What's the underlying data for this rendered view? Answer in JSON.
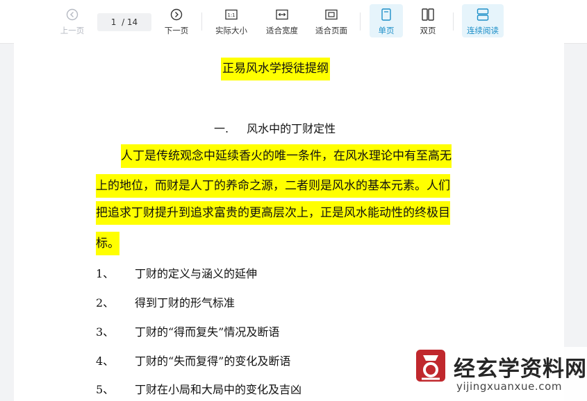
{
  "toolbar": {
    "prev_label": "上一页",
    "page_current": "1",
    "page_total": "/ 14",
    "next_label": "下一页",
    "actual_size_label": "实际大小",
    "fit_width_label": "适合宽度",
    "fit_page_label": "适合页面",
    "single_page_label": "单页",
    "double_page_label": "双页",
    "continuous_label": "连续阅读",
    "accent_color": "#1d8fc8"
  },
  "document": {
    "title": "正易风水学授徒提纲",
    "section": {
      "number": "一.",
      "title": "风水中的丁财定性"
    },
    "paragraph_lines": [
      "人丁是传统观念中延续香火的唯一条件，在风水理论中有至高无",
      "上的地位，而财是人丁的养命之源，二者则是风水的基本元素。人们",
      "把追求丁财提升到追求富贵的更高层次上，正是风水能动性的终极目",
      "标。"
    ],
    "list": [
      {
        "num": "1、",
        "text": "丁财的定义与涵义的延伸"
      },
      {
        "num": "2、",
        "text": "得到丁财的形气标准"
      },
      {
        "num": "3、",
        "text": "丁财的“得而复失”情况及断语"
      },
      {
        "num": "4、",
        "text": "丁财的“失而复得”的变化及断语"
      },
      {
        "num": "5、",
        "text": "丁财在小局和大局中的变化及吉凶"
      }
    ],
    "highlight_color": "#ffff00"
  },
  "watermark": {
    "name": "经玄学资料网",
    "url": "yijingxuanxue.com",
    "logo_color": "#c0282d"
  }
}
